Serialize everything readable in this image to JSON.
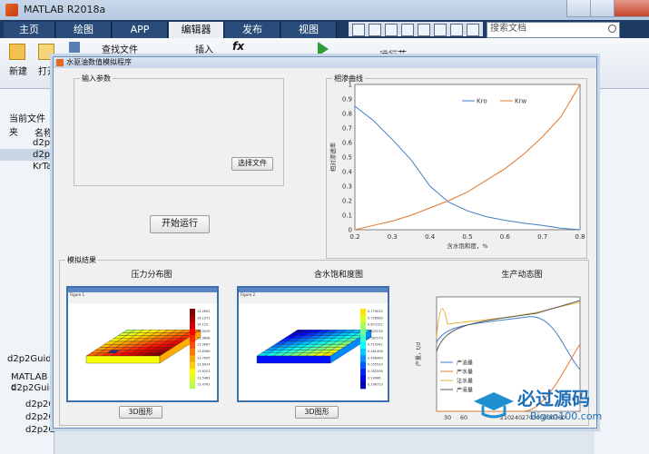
{
  "window": {
    "title": "MATLAB R2018a"
  },
  "tabs": [
    {
      "label": "主页"
    },
    {
      "label": "绘图"
    },
    {
      "label": "APP"
    },
    {
      "label": "编辑器"
    },
    {
      "label": "发布"
    },
    {
      "label": "视图"
    }
  ],
  "search": {
    "placeholder": "搜索文档"
  },
  "ribbon": {
    "new_label": "新建",
    "open_label": "打开",
    "find_files_label": "查找文件",
    "insert_label": "插入",
    "fx_label": "fx",
    "run_section_label": "运行节"
  },
  "left_panel": {
    "current_folder": "当前文件夹",
    "name_header": "名称",
    "files": [
      "d2p2",
      "d2p2",
      "KrTab"
    ],
    "details_title": "d2p2Guide",
    "details_lines": [
      "MATLAB c",
      "d2p2Guide"
    ],
    "bottom_files": [
      "d2p2G",
      "d2p2G",
      "d2p2G"
    ]
  },
  "figure": {
    "title": "水驱油数值模拟程序",
    "input_panel": "输入参数",
    "select_file_button": "选择文件",
    "start_button": "开始运行",
    "results_panel": "模拟结果",
    "pressure_title": "压力分布图",
    "saturation_title": "含水饱和度图",
    "production_title": "生产动态图",
    "button_3d": "3D图形",
    "shot1_title": "Figure 1",
    "shot2_title": "Figure 2"
  },
  "chart_data": [
    {
      "type": "line",
      "title": "相渗曲线",
      "xlabel": "含水饱和度，%",
      "ylabel": "相对渗透率",
      "xlim": [
        0.2,
        0.8
      ],
      "ylim": [
        0,
        1
      ],
      "xticks": [
        "0.2",
        "0.3",
        "0.4",
        "0.5",
        "0.6",
        "0.7",
        "0.8"
      ],
      "yticks": [
        "0",
        "0.1",
        "0.2",
        "0.3",
        "0.4",
        "0.5",
        "0.6",
        "0.7",
        "0.8",
        "0.9",
        "1"
      ],
      "legend_position": "top-center",
      "series": [
        {
          "name": "Kro",
          "color": "#3f7fc4",
          "x": [
            0.2,
            0.25,
            0.3,
            0.35,
            0.4,
            0.45,
            0.5,
            0.55,
            0.6,
            0.65,
            0.7,
            0.75,
            0.8
          ],
          "y": [
            0.85,
            0.75,
            0.62,
            0.48,
            0.3,
            0.19,
            0.13,
            0.09,
            0.065,
            0.045,
            0.03,
            0.01,
            0
          ]
        },
        {
          "name": "Krw",
          "color": "#e0782e",
          "x": [
            0.2,
            0.25,
            0.3,
            0.35,
            0.4,
            0.45,
            0.5,
            0.55,
            0.6,
            0.65,
            0.7,
            0.75,
            0.8
          ],
          "y": [
            0,
            0.03,
            0.06,
            0.1,
            0.15,
            0.2,
            0.26,
            0.34,
            0.42,
            0.52,
            0.64,
            0.78,
            1.0
          ]
        }
      ]
    },
    {
      "type": "line",
      "title": "生产动态图",
      "ylabel": "产量，t/d",
      "xlim": [
        0,
        360
      ],
      "xticks": [
        "30",
        "60",
        "210",
        "240",
        "270",
        "300",
        "330",
        "360"
      ],
      "legend_position": "bottom-left",
      "series": [
        {
          "name": "产油量",
          "color": "#3f7fc4"
        },
        {
          "name": "产水量",
          "color": "#e0782e"
        },
        {
          "name": "注水量",
          "color": "#e6b43a"
        },
        {
          "name": "产液量",
          "color": "#555555"
        }
      ]
    }
  ],
  "colorbars": {
    "pressure": [
      "14.2692",
      "14.1971",
      "14.125",
      "14.0529",
      "13.9808",
      "13.9087",
      "13.8366",
      "13.7645",
      "13.6924",
      "13.6203",
      "13.5482",
      "13.4761"
    ],
    "saturation": [
      "0.779025",
      "0.726089",
      "0.673152",
      "0.620216",
      "0.567279",
      "0.514342",
      "0.461406",
      "0.408469",
      "0.355533",
      "0.302596",
      "0.24966",
      "0.196723"
    ]
  },
  "watermark": {
    "text": "必过源码",
    "url": "Biguo100.com"
  }
}
